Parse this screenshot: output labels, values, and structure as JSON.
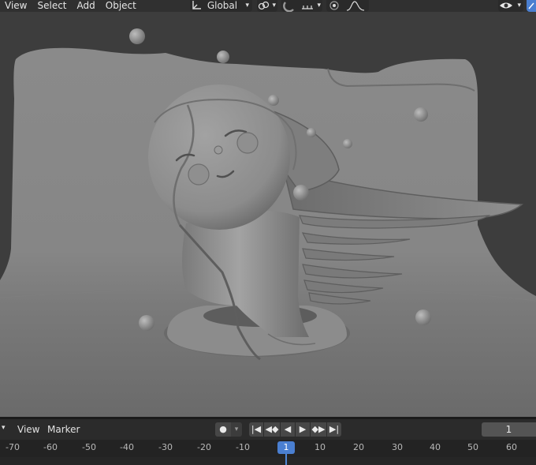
{
  "header": {
    "menu": [
      "View",
      "Select",
      "Add",
      "Object"
    ],
    "orientation": "Global",
    "icons": {
      "transform_orientation": "transform-orientation-icon",
      "pivot": "pivot-link-icon",
      "snap": "snap-magnet-icon",
      "snap_target": "snap-increment-icon",
      "proportional": "proportional-edit-icon",
      "falloff": "falloff-curve-icon",
      "visibility": "eye-visibility-icon",
      "gizmo": "gizmo-toggle-icon"
    }
  },
  "timeline": {
    "menu": [
      "View",
      "Marker"
    ],
    "current_frame": "1",
    "playhead_label": "1",
    "ruler_ticks": [
      "-70",
      "-60",
      "-50",
      "-40",
      "-30",
      "-20",
      "-10",
      "10",
      "20",
      "30",
      "40",
      "50",
      "60"
    ],
    "icons": {
      "editor_type": "editor-type-chevron-icon",
      "record": "record-keyframe-icon",
      "jump_start": "jump-to-start-icon",
      "prev_keyframe": "prev-keyframe-icon",
      "play_reverse": "play-reverse-icon",
      "play": "play-icon",
      "next_keyframe": "next-keyframe-icon",
      "jump_end": "jump-to-end-icon"
    }
  },
  "colors": {
    "accent": "#4a7fd1",
    "header_bg": "#303030",
    "viewport_bg": "#3d3d3d",
    "clay": "#8e8e8e"
  }
}
